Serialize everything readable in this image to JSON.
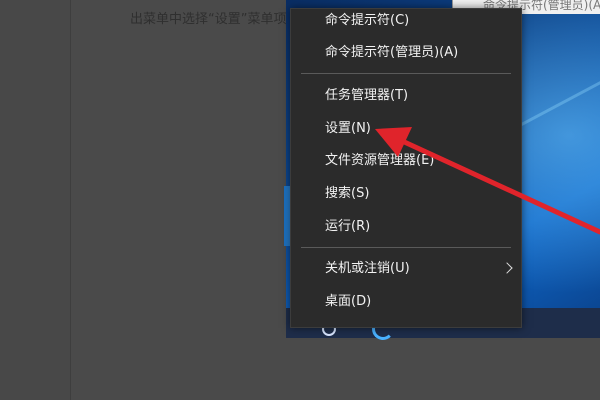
{
  "hint_text": "出菜单中选择“设置”菜单项",
  "top_window_text": "命令提示符(管理员)(A)",
  "menu": {
    "items": [
      {
        "label": "命令提示符(C)"
      },
      {
        "label": "命令提示符(管理员)(A)"
      },
      {
        "label": "任务管理器(T)"
      },
      {
        "label": "设置(N)"
      },
      {
        "label": "文件资源管理器(E)"
      },
      {
        "label": "搜索(S)"
      },
      {
        "label": "运行(R)"
      },
      {
        "label": "关机或注销(U)"
      },
      {
        "label": "桌面(D)"
      }
    ]
  },
  "colors": {
    "menu_background": "#2b2b2b",
    "menu_text": "#f2f2f2",
    "arrow": "#e0242b",
    "desktop_blue": "#0c4d9c"
  },
  "icons": {
    "submenu": "chevron-right-icon",
    "taskbar_search": "search-icon",
    "taskbar_browser": "edge-icon"
  }
}
